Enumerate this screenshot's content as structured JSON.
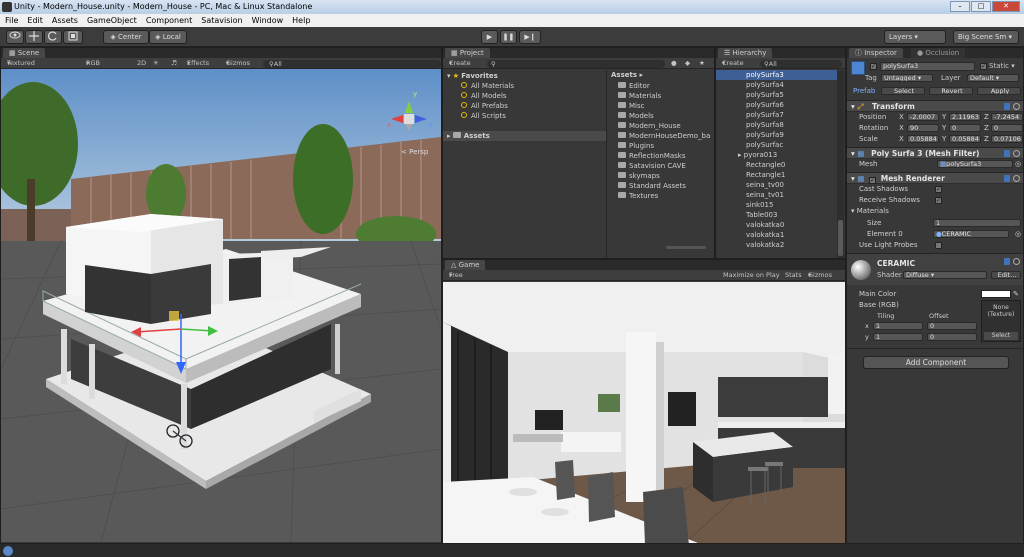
{
  "window": {
    "title": "Unity - Modern_House.unity - Modern_House - PC, Mac & Linux Standalone"
  },
  "menubar": [
    "File",
    "Edit",
    "Assets",
    "GameObject",
    "Component",
    "Satavision",
    "Window",
    "Help"
  ],
  "toolbar": {
    "center": "Center",
    "local": "Local",
    "layers": "Layers",
    "layout": "Big Scene Sm"
  },
  "scene": {
    "tab": "Scene",
    "shading": "Textured",
    "render_mode": "RGB",
    "mode_2d": "2D",
    "effects": "Effects",
    "gizmos": "Gizmos",
    "search": "All",
    "persp": "Persp",
    "axes": {
      "x": "x",
      "y": "y",
      "z": "z"
    }
  },
  "project": {
    "tab": "Project",
    "create": "Create",
    "favorites_label": "Favorites",
    "favorites": [
      "All Materials",
      "All Models",
      "All Prefabs",
      "All Scripts"
    ],
    "assets_tree": "Assets",
    "assets_header": "Assets",
    "folders": [
      "Editor",
      "Materials",
      "Misc",
      "Models",
      "Modern_House",
      "ModernHouseDemo_ba",
      "Plugins",
      "ReflectionMasks",
      "Satavision CAVE",
      "skymaps",
      "Standard Assets",
      "Textures"
    ]
  },
  "hierarchy": {
    "tab": "Hierarchy",
    "create": "Create",
    "search": "All",
    "items": [
      "polySurfa3",
      "polySurfa4",
      "polySurfa5",
      "polySurfa6",
      "polySurfa7",
      "polySurfa8",
      "polySurfa9",
      "polySurfac",
      "pyora013",
      "Rectangle0",
      "Rectangle1",
      "seina_tv00",
      "seina_tv01",
      "sink015",
      "Table003",
      "valokatka0",
      "valokatka1",
      "valokatka2"
    ],
    "selected_index": 0
  },
  "game": {
    "tab": "Game",
    "aspect": "Free Aspect",
    "maximize": "Maximize on Play",
    "stats": "Stats",
    "gizmos": "Gizmos"
  },
  "inspector": {
    "tab": "Inspector",
    "tab2": "Occlusion",
    "object_name": "polySurfa3",
    "static": "Static",
    "tag_label": "Tag",
    "tag_value": "Untagged",
    "layer_label": "Layer",
    "layer_value": "Default",
    "prefab": "Prefab",
    "select": "Select",
    "revert": "Revert",
    "apply": "Apply",
    "transform": {
      "title": "Transform",
      "position_label": "Position",
      "rotation_label": "Rotation",
      "scale_label": "Scale",
      "position": [
        "-2.0007",
        "2.11963",
        "-7.2454"
      ],
      "rotation": [
        "90",
        "0",
        "0"
      ],
      "scale": [
        "0.05884",
        "0.05884",
        "0.07106"
      ]
    },
    "mesh_filter": {
      "title": "Poly Surfa 3 (Mesh Filter)",
      "mesh_label": "Mesh",
      "mesh_value": "polySurfa3"
    },
    "mesh_renderer": {
      "title": "Mesh Renderer",
      "cast_shadows": "Cast Shadows",
      "receive_shadows": "Receive Shadows",
      "materials": "Materials",
      "size_label": "Size",
      "size_value": "1",
      "element0_label": "Element 0",
      "element0_value": "CERAMIC",
      "use_light_probes": "Use Light Probes"
    },
    "material": {
      "name": "CERAMIC",
      "shader_label": "Shader",
      "shader_value": "Diffuse",
      "edit": "Edit...",
      "main_color": "Main Color",
      "base": "Base (RGB)",
      "tiling": "Tiling",
      "offset": "Offset",
      "x_label": "x",
      "y_label": "y",
      "tiling_x": "1",
      "tiling_y": "1",
      "offset_x": "0",
      "offset_y": "0",
      "texture_none": "None (Texture)",
      "texture_select": "Select"
    },
    "add_component": "Add Component"
  },
  "colors": {
    "accent_selection": "#3e5f96",
    "prefab_blue": "#7fb2ff",
    "sky": "#8fb3d9"
  }
}
